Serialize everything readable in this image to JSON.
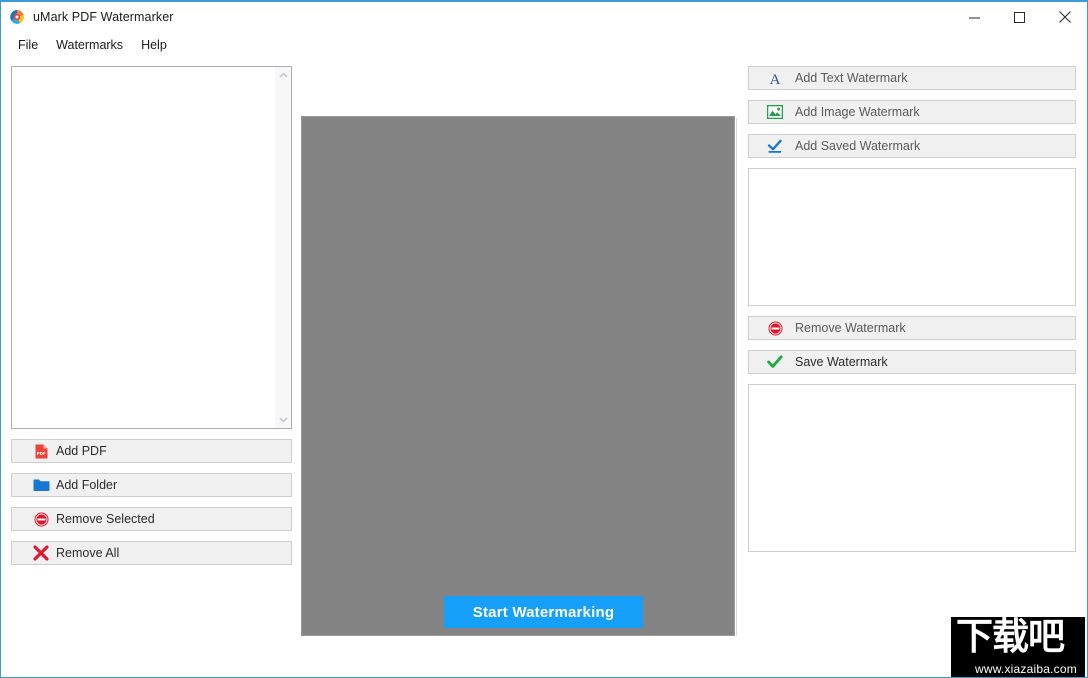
{
  "window": {
    "title": "uMark PDF Watermarker",
    "app_icon": "umark-logo-icon",
    "accent_border_color": "#3d9ada",
    "controls": {
      "minimize": "minimize-icon",
      "maximize": "maximize-icon",
      "close": "close-icon"
    }
  },
  "menubar": {
    "items": [
      {
        "label": "File"
      },
      {
        "label": "Watermarks"
      },
      {
        "label": "Help"
      }
    ]
  },
  "left_panel": {
    "file_list": {
      "items": [],
      "scrollbar": {
        "up_arrow": "chevron-up-icon",
        "down_arrow": "chevron-down-icon"
      }
    },
    "buttons": [
      {
        "label": "Add PDF",
        "icon": "pdf-file-icon",
        "icon_color": "#e8453c"
      },
      {
        "label": "Add Folder",
        "icon": "folder-icon",
        "icon_color": "#1877d2"
      },
      {
        "label": "Remove Selected",
        "icon": "minus-circle-icon",
        "icon_color": "#e0162b"
      },
      {
        "label": "Remove All",
        "icon": "cross-x-icon",
        "icon_color": "#e0162b"
      }
    ]
  },
  "preview": {
    "background_color": "#838383",
    "content": ""
  },
  "right_panel": {
    "add_buttons": [
      {
        "label": "Add Text Watermark",
        "icon": "letter-a-icon",
        "icon_color": "#2b5797"
      },
      {
        "label": "Add Image Watermark",
        "icon": "picture-icon",
        "icon_color": "#22a04b"
      },
      {
        "label": "Add Saved Watermark",
        "icon": "check-underline-icon",
        "icon_color": "#1877d2"
      }
    ],
    "watermark_list": {
      "items": []
    },
    "action_buttons": [
      {
        "label": "Remove Watermark",
        "icon": "minus-circle-icon",
        "icon_color": "#e0162b"
      },
      {
        "label": "Save Watermark",
        "icon": "check-icon",
        "icon_color": "#1eaa3c"
      }
    ],
    "properties_panel": {
      "items": []
    }
  },
  "footer": {
    "start_button": {
      "label": "Start Watermarking",
      "color": "#17a0f9",
      "text_color": "#ffffff"
    },
    "site_watermark": {
      "brand": "下载吧",
      "url": "www.xiazaiba.com"
    }
  }
}
